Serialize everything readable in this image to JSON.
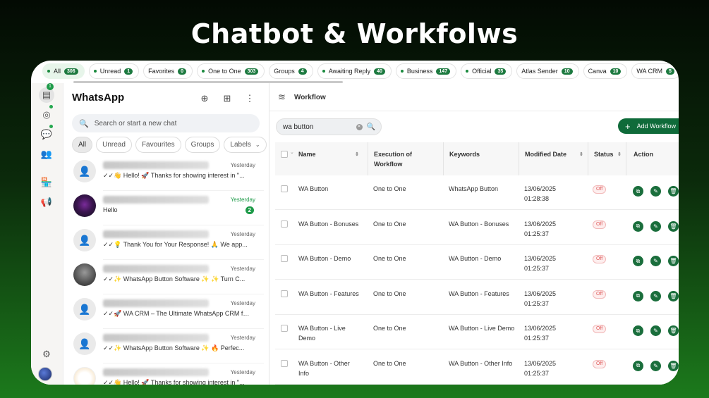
{
  "banner": {
    "title": "Chatbot & Workfolws"
  },
  "filter_tabs": [
    {
      "label": "All",
      "count": "306",
      "active": true,
      "dot": true
    },
    {
      "label": "Unread",
      "count": "1",
      "dot": true
    },
    {
      "label": "Favorites",
      "count": "0",
      "dot": false
    },
    {
      "label": "One to One",
      "count": "303",
      "dot": true
    },
    {
      "label": "Groups",
      "count": "4",
      "dot": false
    },
    {
      "label": "Awaiting Reply",
      "count": "40",
      "dot": true
    },
    {
      "label": "Business",
      "count": "147",
      "dot": true
    },
    {
      "label": "Official",
      "count": "35",
      "dot": true
    },
    {
      "label": "Atlas Sender",
      "count": "10",
      "dot": false
    },
    {
      "label": "Canva",
      "count": "10",
      "dot": false
    },
    {
      "label": "WA CRM",
      "count": "5",
      "dot": false
    }
  ],
  "rail": {
    "chats_badge": "1"
  },
  "chat_panel": {
    "title": "WhatsApp",
    "search_placeholder": "Search or start a new chat",
    "pills": [
      "All",
      "Unread",
      "Favourites",
      "Groups",
      "Labels"
    ],
    "chats": [
      {
        "time": "Yesterday",
        "message": "✓✓👋 Hello! 🚀 Thanks for showing interest in \"...",
        "avatar": "person"
      },
      {
        "time": "Yesterday",
        "message": "Hello",
        "unread": "2",
        "avatar": "dark",
        "time_green": true
      },
      {
        "time": "Yesterday",
        "message": "✓✓💡 Thank You for Your Response! 🙏   We app...",
        "avatar": "person"
      },
      {
        "time": "Yesterday",
        "message": "✓✓✨ WhatsApp Button Software ✨   ✨ Turn C...",
        "avatar": "photo"
      },
      {
        "time": "Yesterday",
        "message": "✓✓🚀 WA CRM – The Ultimate WhatsApp CRM fo...",
        "avatar": "person"
      },
      {
        "time": "Yesterday",
        "message": "✓✓✨ WhatsApp Button Software ✨   🔥 Perfec...",
        "avatar": "person"
      },
      {
        "time": "Yesterday",
        "message": "✓✓👋 Hello! 🚀 Thanks for showing interest in \"...",
        "avatar": "logo"
      }
    ]
  },
  "workflow": {
    "title": "Workflow",
    "search_value": "wa button",
    "add_label": "Add Workflow",
    "columns": {
      "name": "Name",
      "execution": "Execution of Workflow",
      "keywords": "Keywords",
      "modified": "Modified Date",
      "status": "Status",
      "action": "Action"
    },
    "rows": [
      {
        "name": "WA Button",
        "execution": "One to One",
        "keywords": "WhatsApp Button",
        "date": "13/06/2025",
        "time": "01:28:38",
        "status": "Off"
      },
      {
        "name": "WA Button - Bonuses",
        "execution": "One to One",
        "keywords": "WA Button - Bonuses",
        "date": "13/06/2025",
        "time": "01:25:37",
        "status": "Off"
      },
      {
        "name": "WA Button - Demo",
        "execution": "One to One",
        "keywords": "WA Button - Demo",
        "date": "13/06/2025",
        "time": "01:25:37",
        "status": "Off"
      },
      {
        "name": "WA Button - Features",
        "execution": "One to One",
        "keywords": "WA Button - Features",
        "date": "13/06/2025",
        "time": "01:25:37",
        "status": "Off"
      },
      {
        "name": "WA Button - Live Demo",
        "execution": "One to One",
        "keywords": "WA Button - Live Demo",
        "date": "13/06/2025",
        "time": "01:25:37",
        "status": "Off"
      },
      {
        "name": "WA Button - Other Info",
        "execution": "One to One",
        "keywords": "WA Button - Other Info",
        "date": "13/06/2025",
        "time": "01:25:37",
        "status": "Off"
      }
    ]
  },
  "colors": {
    "brand_green": "#1d7a40",
    "button_green": "#0f6b3a",
    "status_off": "#e05a5a"
  }
}
